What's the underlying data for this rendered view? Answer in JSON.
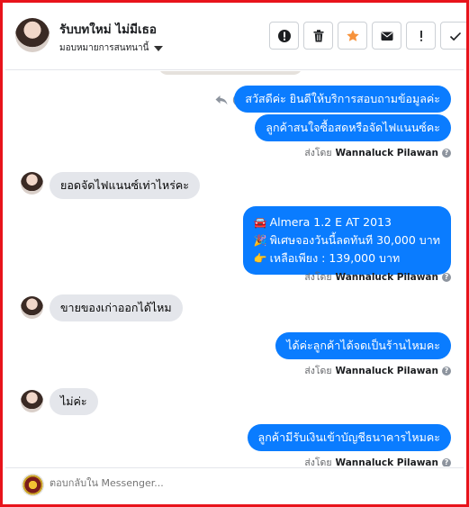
{
  "header": {
    "contact_name": "รับบทใหม่ ไม่มีเธอ",
    "assign_label": "มอบหมายการสนทนานี้",
    "toolbar": [
      {
        "name": "report-spam-button",
        "icon": "alert-circle-icon"
      },
      {
        "name": "delete-button",
        "icon": "trash-icon"
      },
      {
        "name": "star-button",
        "icon": "star-icon"
      },
      {
        "name": "mark-unread-button",
        "icon": "envelope-icon"
      },
      {
        "name": "follow-up-button",
        "icon": "exclamation-icon"
      },
      {
        "name": "mark-done-button",
        "icon": "check-icon"
      }
    ]
  },
  "messages": {
    "out1": "สวัสดีค่ะ  ยินดีให้บริการสอบถามข้อมูลค่ะ",
    "out2": "ลูกค้าสนใจซื้อสดหรือจัดไฟแนนซ์คะ",
    "sent_by_prefix": "ส่งโดย",
    "sender_name": "Wannaluck Pilawan",
    "in1": "ยอดจัดไฟแนนซ์เท่าไหร่คะ",
    "out3": {
      "line1_emoji": "🚘",
      "line1": "Almera 1.2 E AT 2013",
      "line2_emoji": "🎉",
      "line2": "พิเศษจองวันนี้ลดทันที 30,000 บาท",
      "line3_emoji": "👉",
      "line3": "เหลือเพียง : 139,000 บาท"
    },
    "in2": "ขายของเก่าออกได้ไหม",
    "out4": "ได้ค่ะลูกค้าได้จดเป็นร้านไหมคะ",
    "in3": "ไม่ค่ะ",
    "out5": "ลูกค้ามีรับเงินเข้าบัญชีธนาคารไหมคะ"
  },
  "footer": {
    "reply_placeholder": "ตอบกลับใน Messenger..."
  },
  "colors": {
    "frame_border": "#e8131b",
    "outgoing_bubble": "#0a7cff",
    "incoming_bubble": "#e4e6eb",
    "star": "#f7923a"
  }
}
